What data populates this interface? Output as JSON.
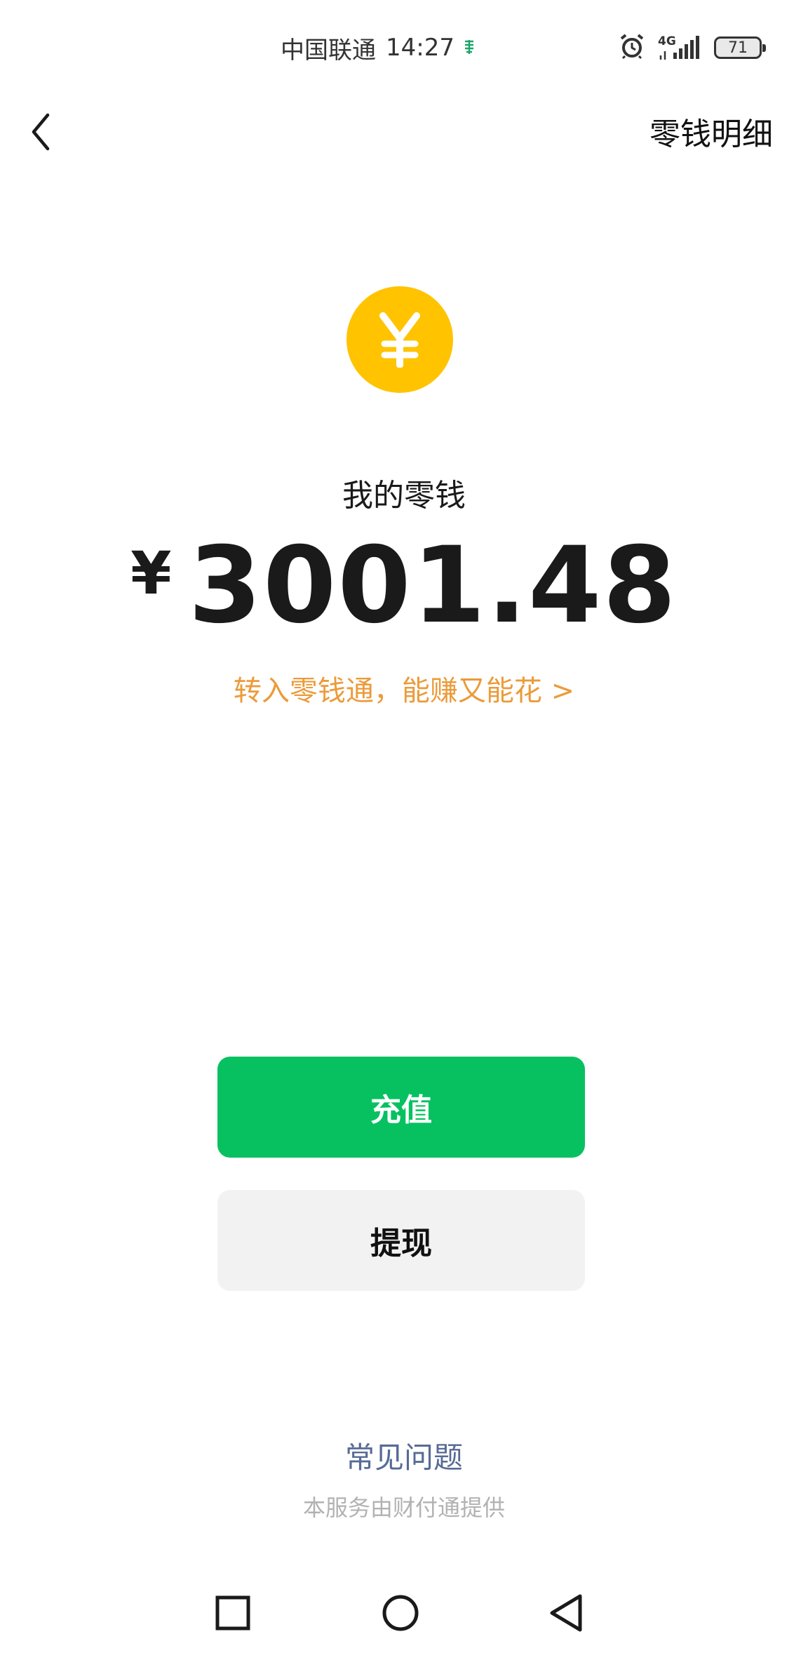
{
  "status_bar": {
    "carrier": "中国联通",
    "time": "14:27",
    "network": "4G",
    "battery": "71"
  },
  "nav": {
    "detail_link": "零钱明细"
  },
  "balance": {
    "label": "我的零钱",
    "currency_symbol": "¥",
    "amount": "3001.48",
    "promo": "转入零钱通，能赚又能花 >"
  },
  "actions": {
    "topup_label": "充值",
    "withdraw_label": "提现"
  },
  "footer": {
    "faq": "常见问题",
    "provider_note": "本服务由财付通提供"
  },
  "colors": {
    "primary_green": "#07c160",
    "coin_yellow": "#ffc300",
    "promo_orange": "#eb9b3a",
    "link_blue": "#576b95"
  },
  "icons": {
    "back": "chevron-left-icon",
    "coin": "yen-coin-icon",
    "alarm": "alarm-icon",
    "signal": "signal-icon",
    "nav_square": "recent-apps-icon",
    "nav_circle": "home-icon",
    "nav_triangle": "back-triangle-icon"
  }
}
